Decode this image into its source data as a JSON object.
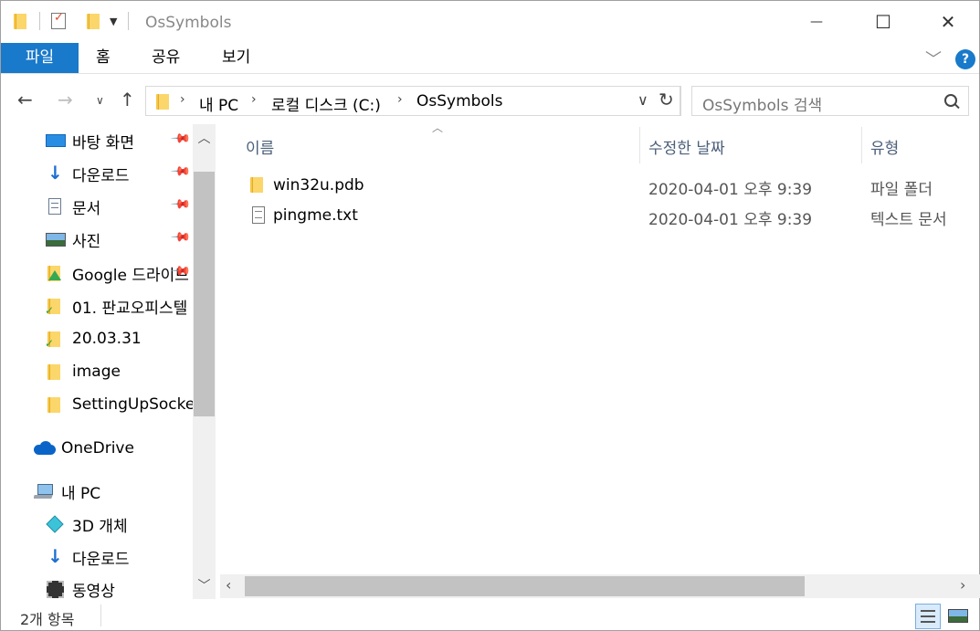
{
  "window": {
    "title": "OsSymbols",
    "controls": {
      "minimize": "—",
      "maximize": "☐",
      "close": "✕"
    }
  },
  "ribbon": {
    "tabs": [
      "파일",
      "홈",
      "공유",
      "보기"
    ],
    "help": "?"
  },
  "address_bar": {
    "crumbs": [
      "내 PC",
      "로컬 디스크 (C:)",
      "OsSymbols"
    ],
    "search_placeholder": "OsSymbols 검색"
  },
  "nav_pane": {
    "quick_access": [
      {
        "label": "바탕 화면",
        "icon": "desktop-icon",
        "pinned": true
      },
      {
        "label": "다운로드",
        "icon": "download-arrow-icon",
        "pinned": true
      },
      {
        "label": "문서",
        "icon": "document-icon",
        "pinned": true
      },
      {
        "label": "사진",
        "icon": "pictures-icon",
        "pinned": true
      },
      {
        "label": "Google 드라이브",
        "icon": "google-drive-folder-icon",
        "pinned": true
      },
      {
        "label": "01. 판교오피스텔",
        "icon": "synced-folder-icon",
        "pinned": false
      },
      {
        "label": "20.03.31",
        "icon": "synced-folder-icon",
        "pinned": false
      },
      {
        "label": "image",
        "icon": "folder-icon",
        "pinned": false
      },
      {
        "label": "SettingUpSocket",
        "icon": "folder-icon",
        "pinned": false
      }
    ],
    "onedrive": "OneDrive",
    "this_pc": "내 PC",
    "pc_items": [
      {
        "label": "3D 개체",
        "icon": "3d-objects-icon"
      },
      {
        "label": "다운로드",
        "icon": "download-arrow-icon"
      },
      {
        "label": "동영상",
        "icon": "video-icon"
      }
    ]
  },
  "file_list": {
    "columns": [
      "이름",
      "수정한 날짜",
      "유형"
    ],
    "rows": [
      {
        "name": "win32u.pdb",
        "date": "2020-04-01 오후 9:39",
        "type": "파일 폴더",
        "icon": "folder-icon"
      },
      {
        "name": "pingme.txt",
        "date": "2020-04-01 오후 9:39",
        "type": "텍스트 문서",
        "icon": "text-file-icon"
      }
    ]
  },
  "status_bar": {
    "count": "2개 항목"
  },
  "colors": {
    "accent": "#1979ca",
    "folder": "#fbd66b"
  }
}
